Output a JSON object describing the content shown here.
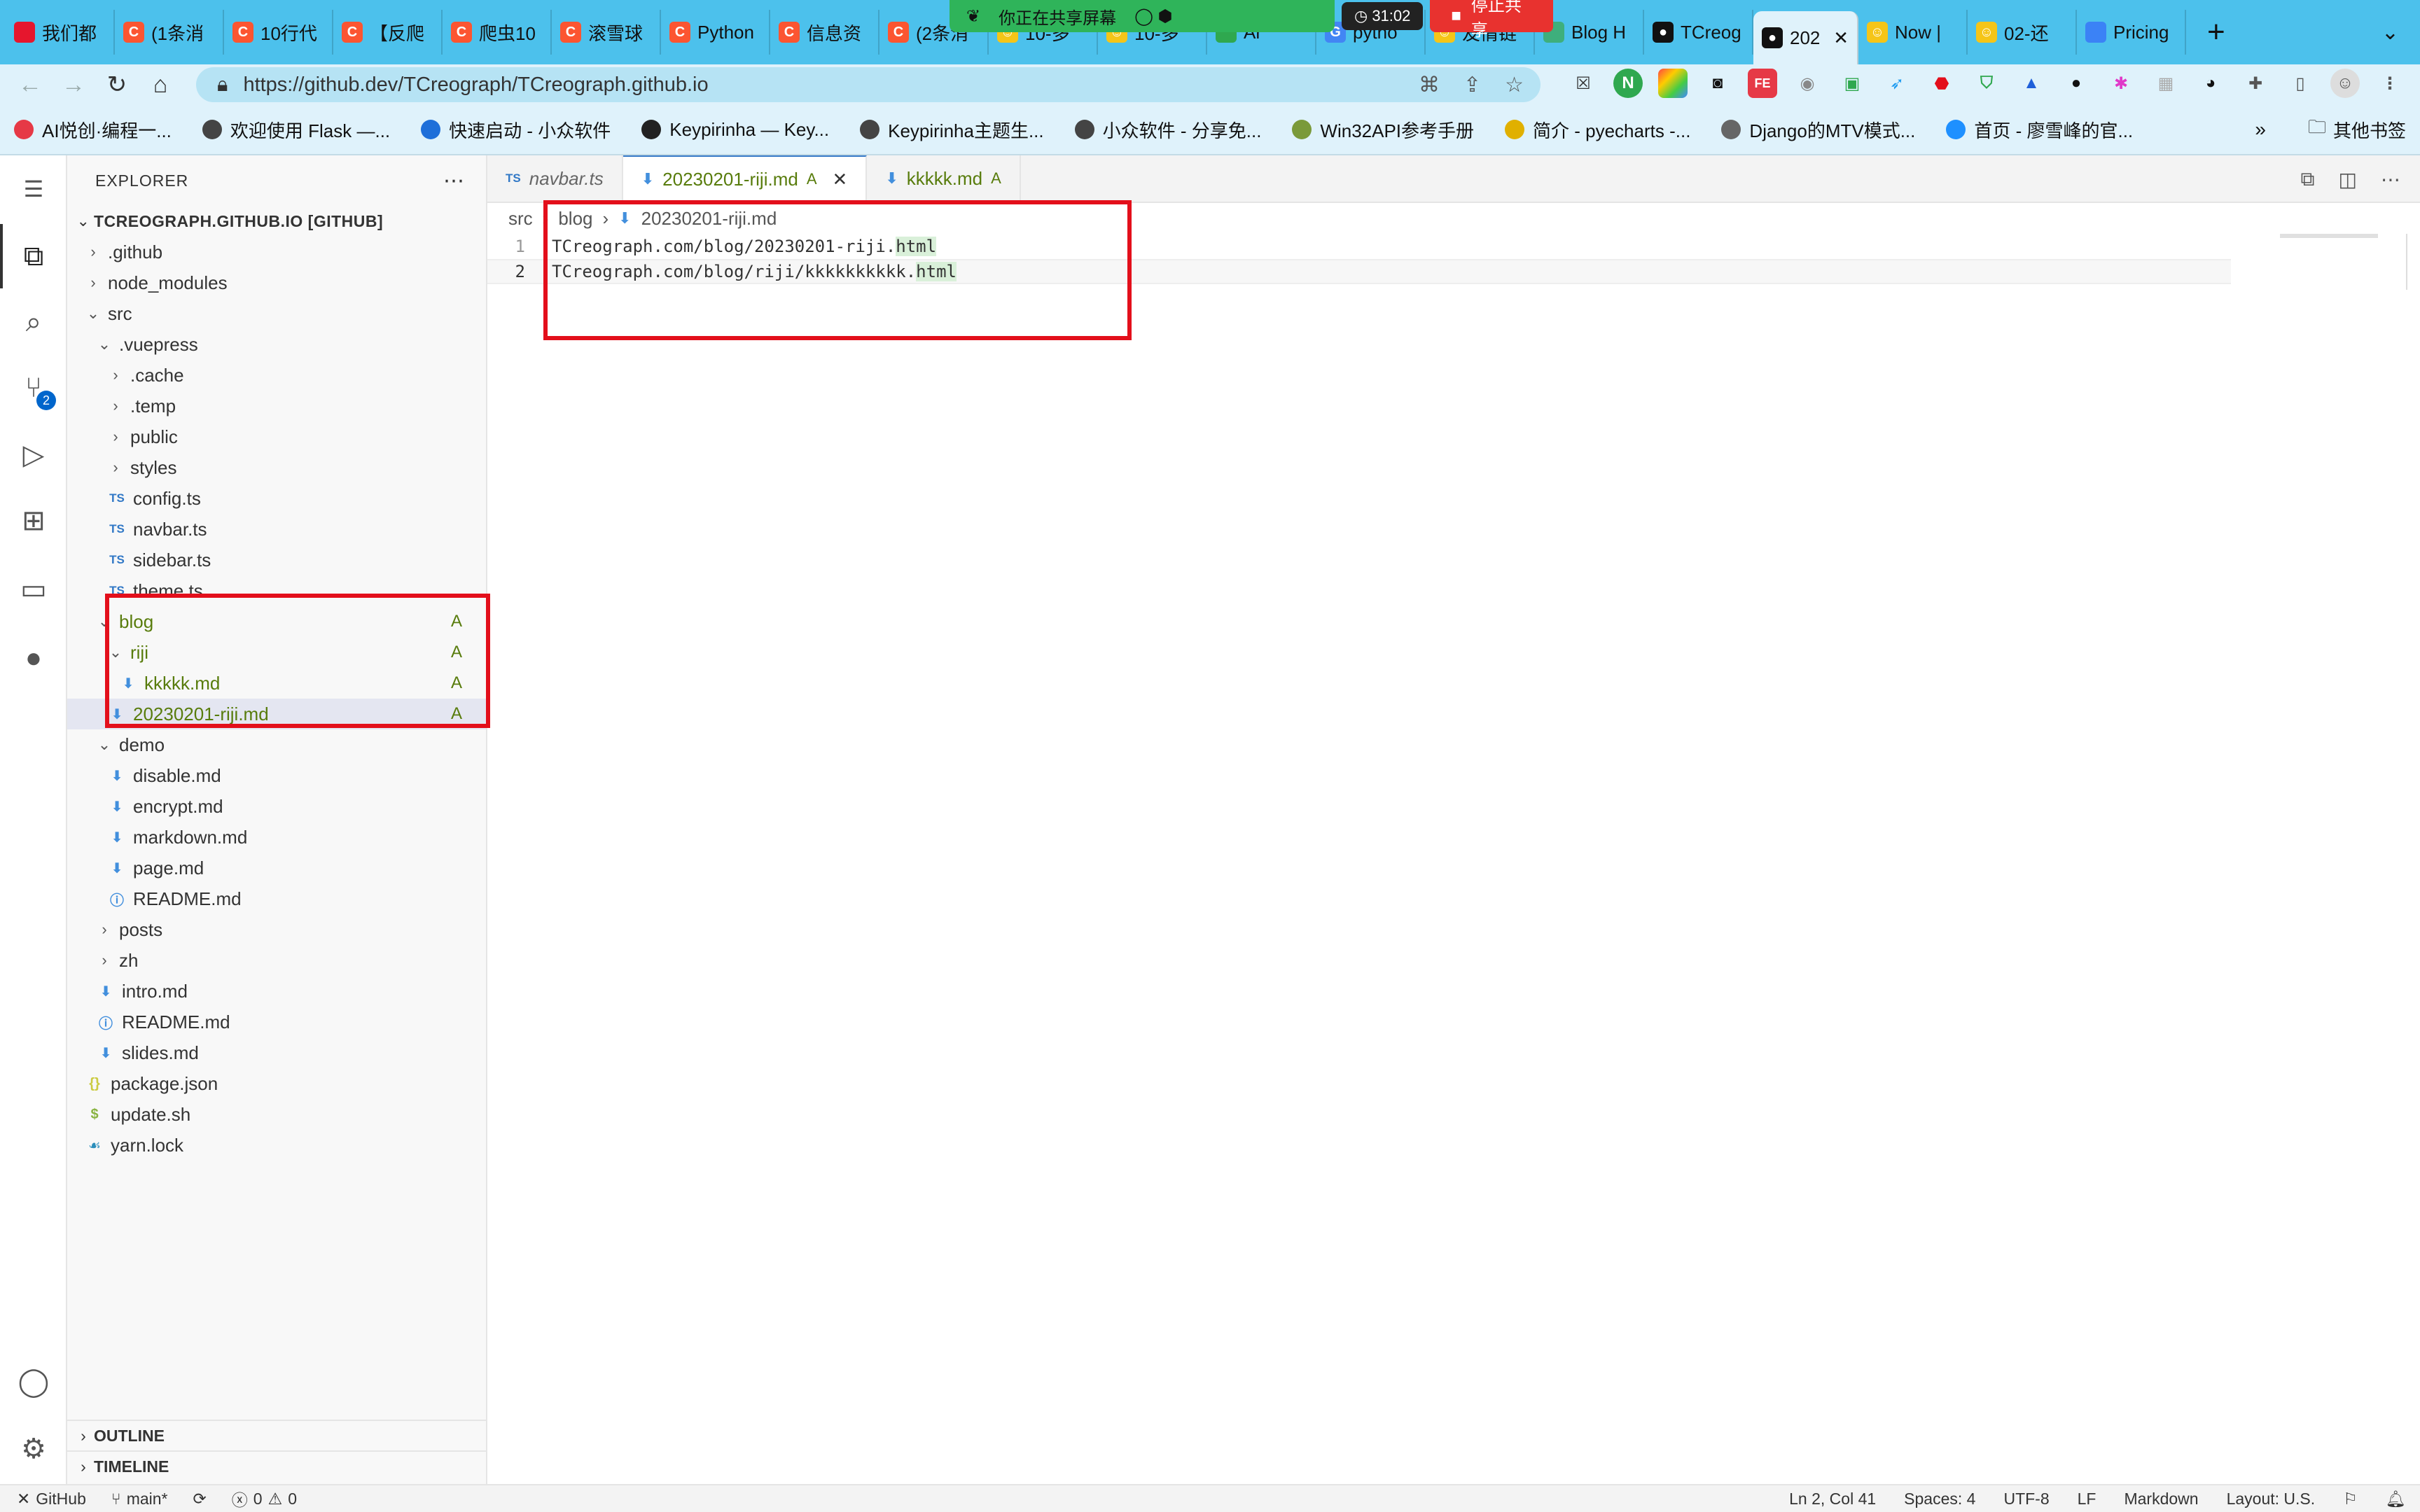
{
  "browser": {
    "tabs": [
      {
        "label": "我们都",
        "icon": "weibo-icon",
        "color": "#e6162d"
      },
      {
        "label": "(1条消",
        "icon": "csdn-icon",
        "color": "#fc5531"
      },
      {
        "label": "10行代",
        "icon": "csdn-icon",
        "color": "#fc5531"
      },
      {
        "label": "【反爬",
        "icon": "csdn-icon",
        "color": "#fc5531"
      },
      {
        "label": "爬虫10",
        "icon": "csdn-icon",
        "color": "#fc5531"
      },
      {
        "label": "滚雪球",
        "icon": "csdn-icon",
        "color": "#fc5531"
      },
      {
        "label": "Python",
        "icon": "csdn-icon",
        "color": "#fc5531"
      },
      {
        "label": "信息资",
        "icon": "csdn-icon",
        "color": "#fc5531"
      },
      {
        "label": "(2条消",
        "icon": "csdn-icon",
        "color": "#fc5531"
      },
      {
        "label": "10-多",
        "icon": "smile-icon",
        "color": "#f5c518"
      },
      {
        "label": "10-多",
        "icon": "smile-icon",
        "color": "#f5c518"
      },
      {
        "label": "Ar",
        "icon": "leaf-icon",
        "color": "#2fa84f"
      },
      {
        "label": "pytho",
        "icon": "google-icon",
        "color": "#4285f4"
      },
      {
        "label": "友情链",
        "icon": "smile-icon",
        "color": "#f5c518"
      },
      {
        "label": "Blog H",
        "icon": "vuepress-icon",
        "color": "#3eaf7c"
      },
      {
        "label": "TCreog",
        "icon": "github-icon",
        "color": "#111111"
      },
      {
        "label": "202",
        "icon": "github-icon",
        "color": "#111111",
        "active": true
      },
      {
        "label": "Now |",
        "icon": "smile-icon",
        "color": "#f5c518"
      },
      {
        "label": "02-还",
        "icon": "smile-icon",
        "color": "#f5c518"
      },
      {
        "label": "Pricing",
        "icon": "pricing-icon",
        "color": "#3b82f6"
      }
    ],
    "share": {
      "sharing_text": "你正在共享屏幕",
      "timer": "31:02",
      "stop_label": "停止共享"
    },
    "url": "https://github.dev/TCreograph/TCreograph.github.io",
    "bookmarks": [
      {
        "label": "AI悦创·编程一...",
        "color": "#e63946"
      },
      {
        "label": "欢迎使用 Flask —...",
        "color": "#444444"
      },
      {
        "label": "快速启动 - 小众软件",
        "color": "#1e6fd9"
      },
      {
        "label": "Keypirinha — Key...",
        "color": "#222222"
      },
      {
        "label": "Keypirinha主题生...",
        "color": "#444444"
      },
      {
        "label": "小众软件 - 分享免...",
        "color": "#444444"
      },
      {
        "label": "Win32API参考手册",
        "color": "#7a9a3a"
      },
      {
        "label": "简介 - pyecharts -...",
        "color": "#e0b000"
      },
      {
        "label": "Django的MTV模式...",
        "color": "#666666"
      },
      {
        "label": "首页 - 廖雪峰的官...",
        "color": "#1e90ff"
      }
    ],
    "bookmarks_more": "»",
    "other_bookmarks": "其他书签"
  },
  "explorer": {
    "title": "EXPLORER",
    "root": "TCREOGRAPH.GITHUB.IO [GITHUB]",
    "tree": [
      {
        "indent": 0,
        "chev": "›",
        "label": ".github"
      },
      {
        "indent": 0,
        "chev": "›",
        "label": "node_modules"
      },
      {
        "indent": 0,
        "chev": "⌄",
        "label": "src"
      },
      {
        "indent": 1,
        "chev": "⌄",
        "label": ".vuepress"
      },
      {
        "indent": 2,
        "chev": "›",
        "label": ".cache"
      },
      {
        "indent": 2,
        "chev": "›",
        "label": ".temp"
      },
      {
        "indent": 2,
        "chev": "›",
        "label": "public"
      },
      {
        "indent": 2,
        "chev": "›",
        "label": "styles"
      },
      {
        "indent": 2,
        "file": "ts",
        "label": "config.ts"
      },
      {
        "indent": 2,
        "file": "ts",
        "label": "navbar.ts"
      },
      {
        "indent": 2,
        "file": "ts",
        "label": "sidebar.ts"
      },
      {
        "indent": 2,
        "file": "ts",
        "label": "theme.ts"
      },
      {
        "indent": 1,
        "chev": "⌄",
        "label": "blog",
        "git": "A"
      },
      {
        "indent": 2,
        "chev": "⌄",
        "label": "riji",
        "git": "A"
      },
      {
        "indent": 3,
        "file": "md",
        "label": "kkkkk.md",
        "git": "A"
      },
      {
        "indent": 2,
        "file": "md",
        "label": "20230201-riji.md",
        "git": "A",
        "selected": true
      },
      {
        "indent": 1,
        "chev": "⌄",
        "label": "demo"
      },
      {
        "indent": 2,
        "file": "md",
        "label": "disable.md"
      },
      {
        "indent": 2,
        "file": "md",
        "label": "encrypt.md"
      },
      {
        "indent": 2,
        "file": "md",
        "label": "markdown.md"
      },
      {
        "indent": 2,
        "file": "md",
        "label": "page.md"
      },
      {
        "indent": 2,
        "file": "info",
        "label": "README.md"
      },
      {
        "indent": 1,
        "chev": "›",
        "label": "posts"
      },
      {
        "indent": 1,
        "chev": "›",
        "label": "zh"
      },
      {
        "indent": 1,
        "file": "md",
        "label": "intro.md"
      },
      {
        "indent": 1,
        "file": "info",
        "label": "README.md"
      },
      {
        "indent": 1,
        "file": "md",
        "label": "slides.md"
      },
      {
        "indent": 0,
        "file": "json",
        "label": "package.json"
      },
      {
        "indent": 0,
        "file": "sh",
        "label": "update.sh"
      },
      {
        "indent": 0,
        "file": "yarn",
        "label": "yarn.lock"
      }
    ],
    "outline": "OUTLINE",
    "timeline": "TIMELINE"
  },
  "activity": {
    "scm_badge": "2"
  },
  "editor": {
    "tabs": [
      {
        "label": "navbar.ts",
        "type": "ts"
      },
      {
        "label": "20230201-riji.md",
        "type": "md",
        "status": "A",
        "active": true
      },
      {
        "label": "kkkkk.md",
        "type": "md",
        "status": "A"
      }
    ],
    "breadcrumbs": [
      "src",
      "blog",
      "20230201-riji.md"
    ],
    "lines": [
      {
        "no": "1",
        "pre": "TCreograph.com/blog/20230201-riji.",
        "hl": "html"
      },
      {
        "no": "2",
        "pre": "TCreograph.com/blog/riji/kkkkkkkkkk.",
        "hl": "html"
      }
    ]
  },
  "status": {
    "remote": "GitHub",
    "branch": "main*",
    "errors": "0",
    "warnings": "0",
    "position": "Ln 2, Col 41",
    "spaces": "Spaces: 4",
    "encoding": "UTF-8",
    "eol": "LF",
    "language": "Markdown",
    "layout": "Layout: U.S."
  }
}
